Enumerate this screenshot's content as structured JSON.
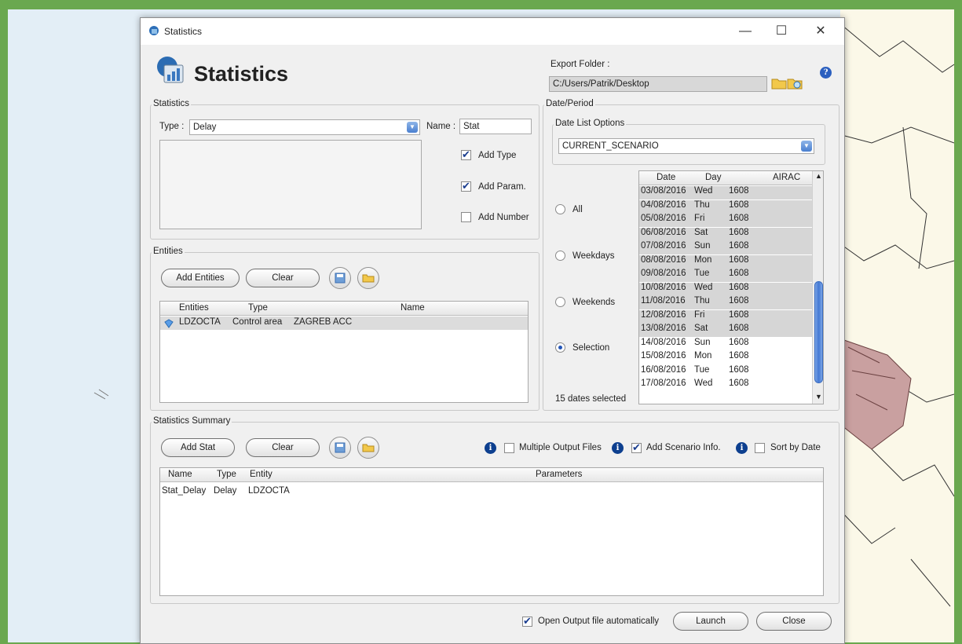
{
  "window": {
    "title": "Statistics",
    "heading": "Statistics"
  },
  "export": {
    "label": "Export Folder :",
    "path": "C:/Users/Patrik/Desktop"
  },
  "statistics": {
    "group": "Statistics",
    "type_label": "Type :",
    "type_value": "Delay",
    "name_label": "Name :",
    "name_value": "Stat",
    "add_type": "Add Type",
    "add_param": "Add Param.",
    "add_number": "Add Number"
  },
  "entities": {
    "group": "Entities",
    "add_button": "Add Entities",
    "clear_button": "Clear",
    "columns": [
      "Entities",
      "Type",
      "Name"
    ],
    "rows": [
      {
        "entity": "LDZOCTA",
        "type": "Control area",
        "name": "ZAGREB ACC"
      }
    ]
  },
  "date_period": {
    "group": "Date/Period",
    "options_group": "Date List Options",
    "options_value": "CURRENT_SCENARIO",
    "radios": [
      "All",
      "Weekdays",
      "Weekends",
      "Selection"
    ],
    "selected_radio": "Selection",
    "columns": [
      "Date",
      "Day",
      "AIRAC"
    ],
    "rows": [
      {
        "date": "03/08/2016",
        "day": "Wed",
        "airac": "1608",
        "sel": true
      },
      {
        "date": "04/08/2016",
        "day": "Thu",
        "airac": "1608",
        "sel": true
      },
      {
        "date": "05/08/2016",
        "day": "Fri",
        "airac": "1608",
        "sel": true
      },
      {
        "date": "06/08/2016",
        "day": "Sat",
        "airac": "1608",
        "sel": true
      },
      {
        "date": "07/08/2016",
        "day": "Sun",
        "airac": "1608",
        "sel": true
      },
      {
        "date": "08/08/2016",
        "day": "Mon",
        "airac": "1608",
        "sel": true
      },
      {
        "date": "09/08/2016",
        "day": "Tue",
        "airac": "1608",
        "sel": true
      },
      {
        "date": "10/08/2016",
        "day": "Wed",
        "airac": "1608",
        "sel": true
      },
      {
        "date": "11/08/2016",
        "day": "Thu",
        "airac": "1608",
        "sel": true
      },
      {
        "date": "12/08/2016",
        "day": "Fri",
        "airac": "1608",
        "sel": true
      },
      {
        "date": "13/08/2016",
        "day": "Sat",
        "airac": "1608",
        "sel": true
      },
      {
        "date": "14/08/2016",
        "day": "Sun",
        "airac": "1608",
        "sel": false
      },
      {
        "date": "15/08/2016",
        "day": "Mon",
        "airac": "1608",
        "sel": false
      },
      {
        "date": "16/08/2016",
        "day": "Tue",
        "airac": "1608",
        "sel": false
      },
      {
        "date": "17/08/2016",
        "day": "Wed",
        "airac": "1608",
        "sel": false
      }
    ],
    "count_text": "15 dates selected"
  },
  "summary": {
    "group": "Statistics Summary",
    "add_button": "Add Stat",
    "clear_button": "Clear",
    "multiple_output": "Multiple Output Files",
    "add_scenario": "Add Scenario Info.",
    "sort_by_date": "Sort by Date",
    "columns": [
      "Name",
      "Type",
      "Entity",
      "Parameters"
    ],
    "rows": [
      {
        "name": "Stat_Delay",
        "type": "Delay",
        "entity": "LDZOCTA",
        "parameters": ""
      }
    ]
  },
  "footer": {
    "open_output": "Open Output file automatically",
    "launch": "Launch",
    "close": "Close"
  }
}
